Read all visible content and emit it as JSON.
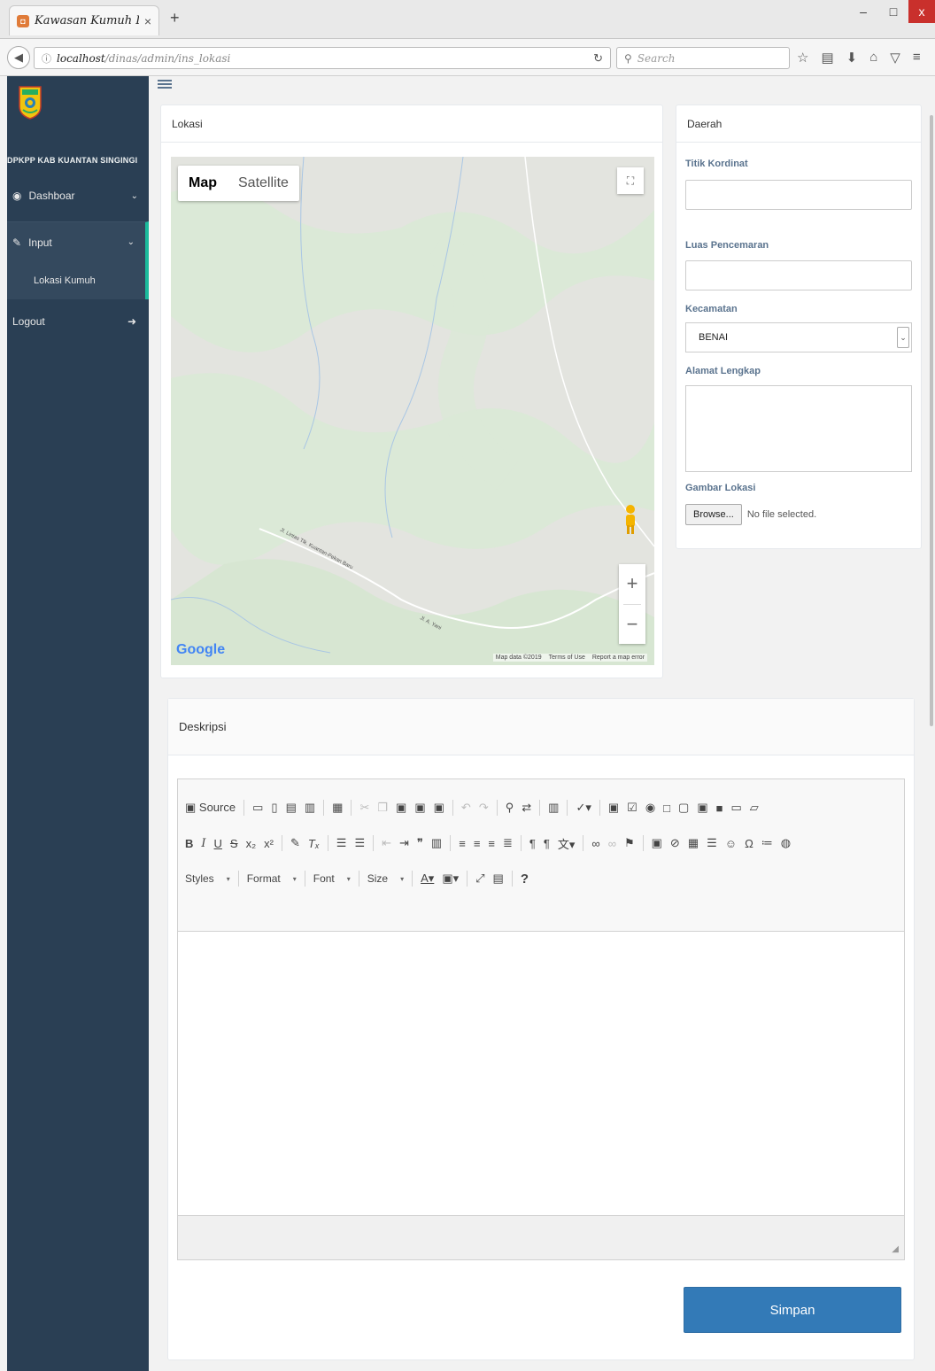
{
  "browser": {
    "tab_title": "Kawasan Kumuh Di K...",
    "tab_close": "×",
    "new_tab": "+",
    "url_host": "localhost",
    "url_path": "/dinas/admin/ins_lokasi",
    "search_placeholder": "Search",
    "win_minimize": "‒",
    "win_maximize": "□",
    "win_close": "x"
  },
  "sidebar": {
    "org_name": "DPKPP KAB KUANTAN SINGINGI",
    "items": [
      {
        "label": "Dashboar",
        "icon": "dashboard-icon"
      },
      {
        "label": "Input",
        "icon": "pencil-icon"
      },
      {
        "label": "Lokasi Kumuh"
      },
      {
        "label": "Logout",
        "icon": "sign-out-icon"
      }
    ]
  },
  "lokasi": {
    "title": "Lokasi",
    "map_tabs": [
      "Map",
      "Satellite"
    ],
    "google": "Google",
    "attribution": [
      "Map data ©2019",
      "Terms of Use",
      "Report a map error"
    ],
    "road_labels": [
      "Jl. Lintas Tlk. Kuantan-Pekan Baru",
      "Jl. A. Yani"
    ]
  },
  "daerah": {
    "title": "Daerah",
    "fields": {
      "titik_kordinat": "Titik Kordinat",
      "luas_pencemaran": "Luas Pencemaran",
      "kecamatan": "Kecamatan",
      "kecamatan_value": "BENAI",
      "alamat": "Alamat Lengkap",
      "gambar": "Gambar Lokasi",
      "browse": "Browse...",
      "no_file": "No file selected."
    }
  },
  "deskripsi": {
    "title": "Deskripsi",
    "source_label": "Source",
    "combos": [
      "Styles",
      "Format",
      "Font",
      "Size"
    ],
    "save_label": "Simpan"
  }
}
